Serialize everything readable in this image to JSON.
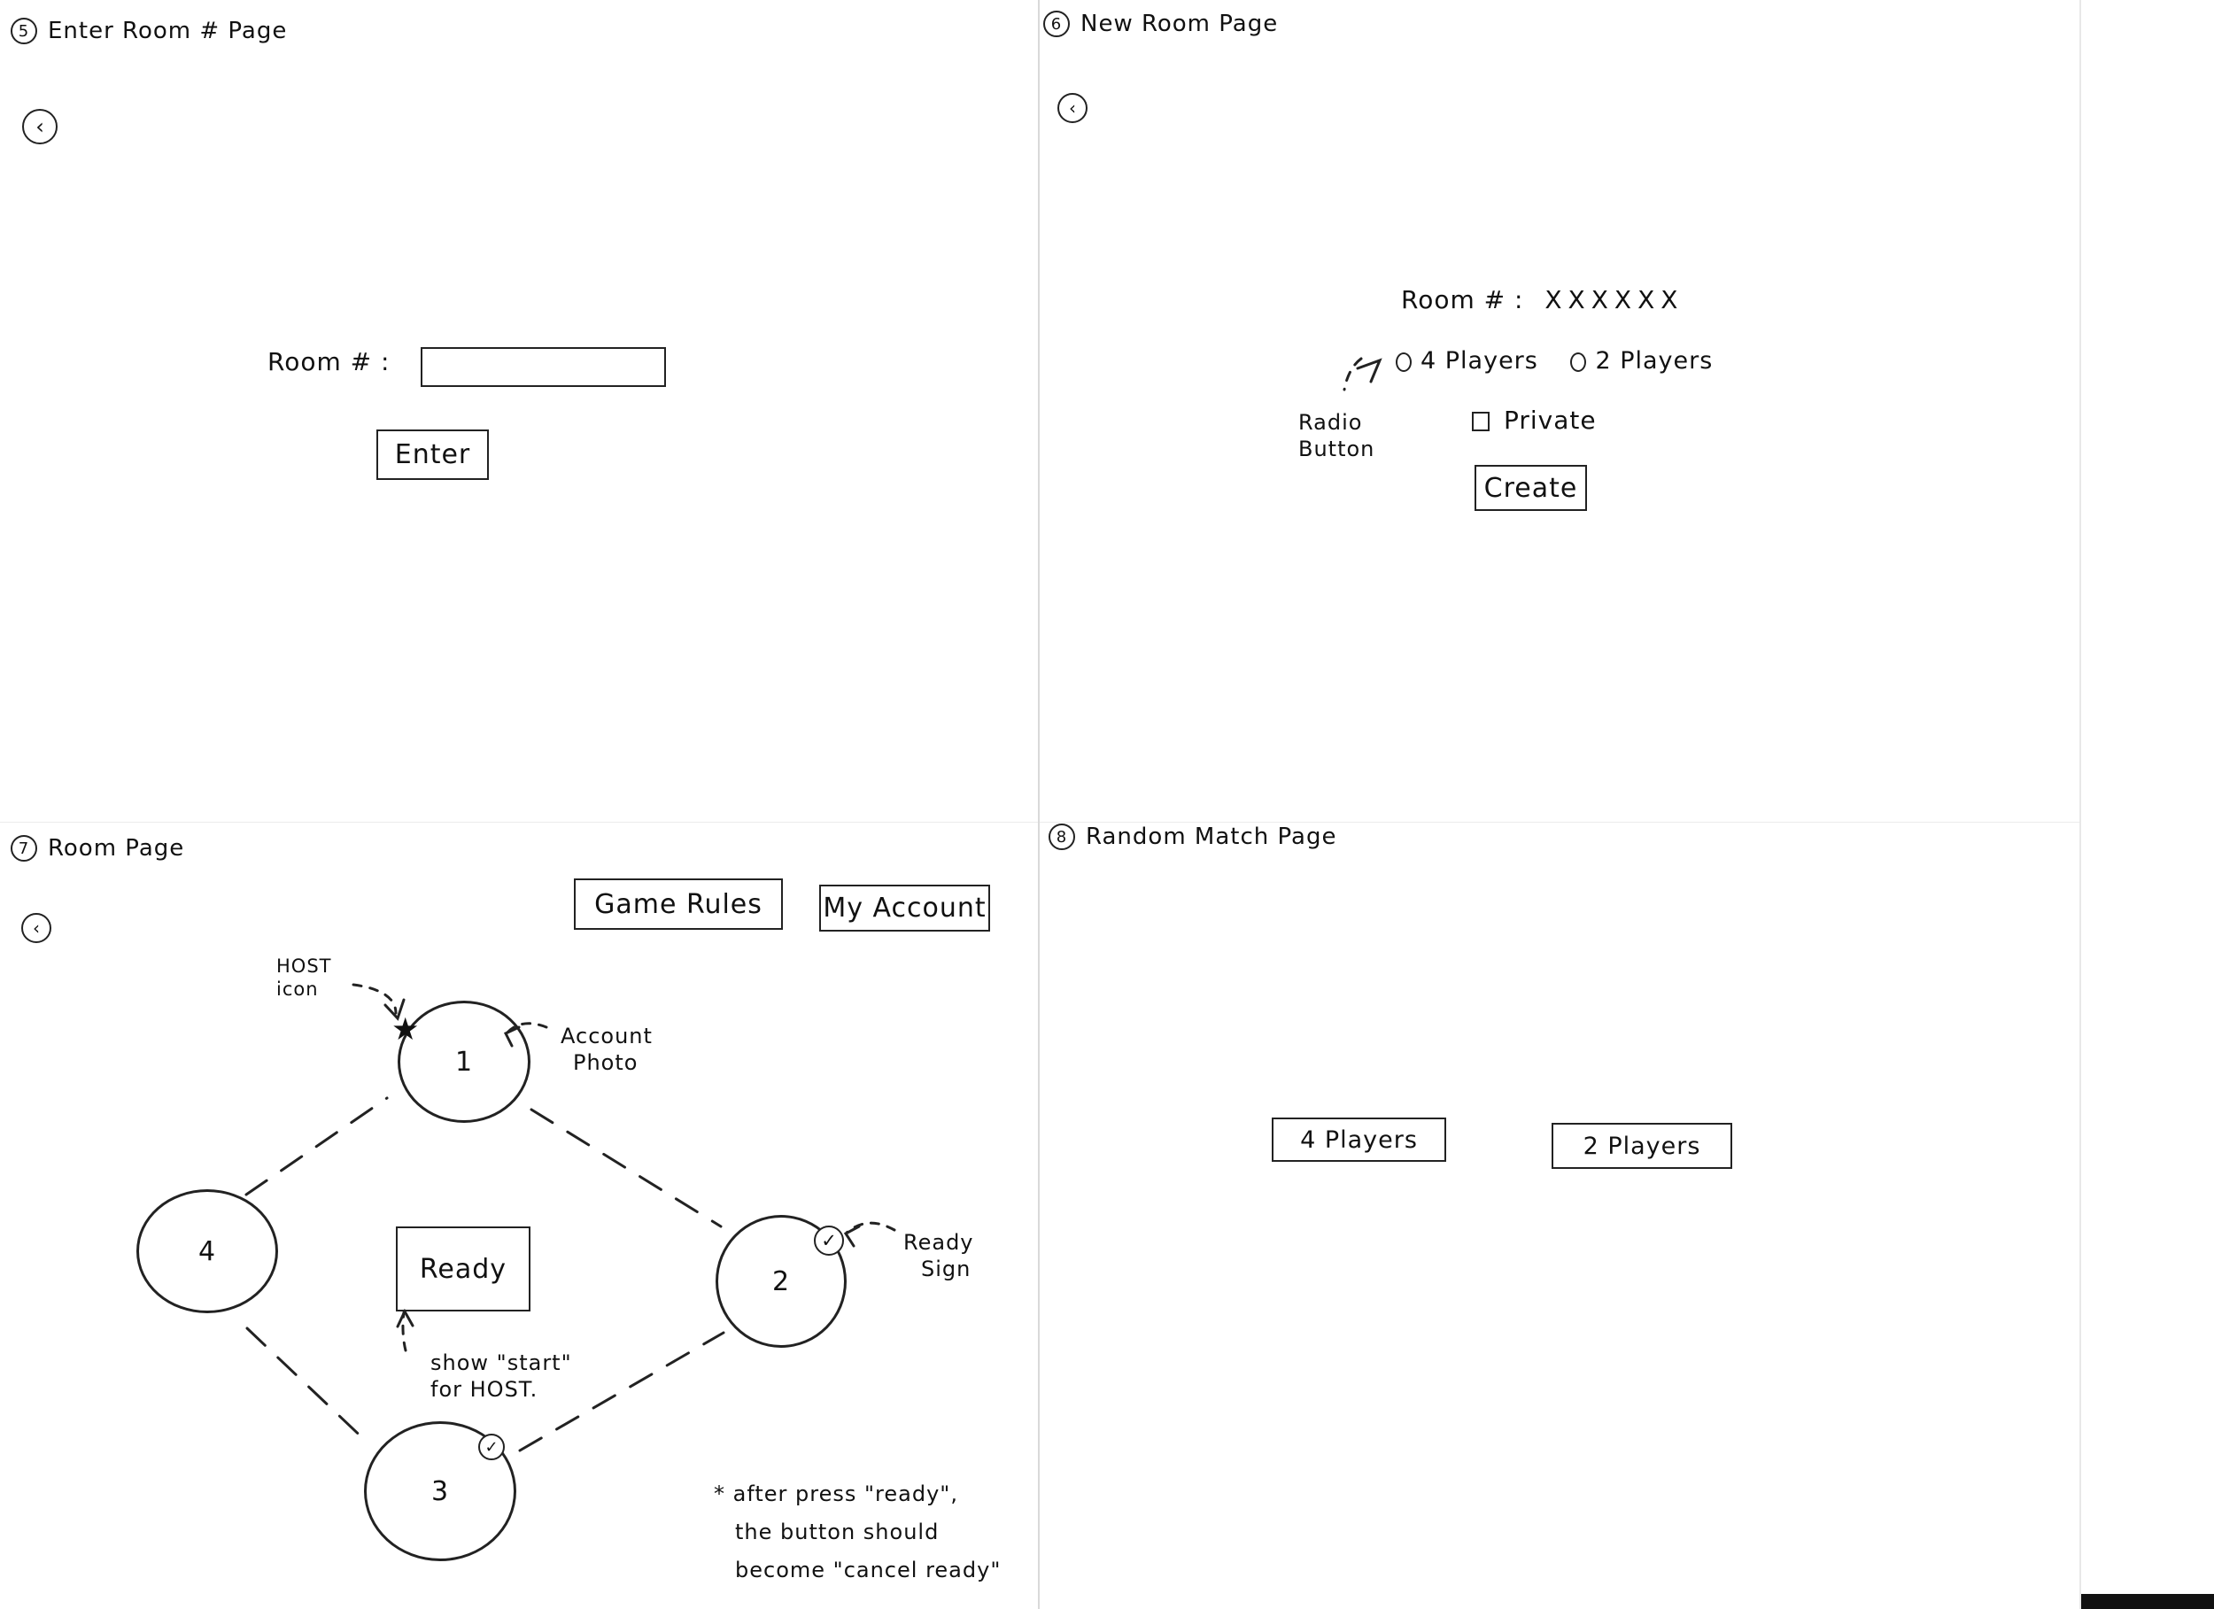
{
  "panels": {
    "enter_room": {
      "badge": "5",
      "title": "Enter Room # Page",
      "back_icon": "back-arrow-icon",
      "room_label": "Room # :",
      "room_value": "",
      "enter_button": "Enter"
    },
    "new_room": {
      "badge": "6",
      "title": "New Room Page",
      "back_icon": "back-arrow-icon",
      "room_label": "Room # :",
      "room_value": "XXXXXX",
      "radio_4": "4 Players",
      "radio_2": "2 Players",
      "private_label": "Private",
      "create_button": "Create",
      "radio_note_1": "Radio",
      "radio_note_2": "Button"
    },
    "room": {
      "badge": "7",
      "title": "Room Page",
      "back_icon": "back-arrow-icon",
      "game_rules_button": "Game Rules",
      "my_account_button": "My Account",
      "host_note_1": "HOST",
      "host_note_2": "icon",
      "account_note_1": "Account",
      "account_note_2": "Photo",
      "ready_note_1": "Ready",
      "ready_note_2": "Sign",
      "ready_button": "Ready",
      "start_note_1": "show \"start\"",
      "start_note_2": "for HOST.",
      "footer_note_1": "* after press \"ready\",",
      "footer_note_2": "the button should",
      "footer_note_3": "become \"cancel ready\"",
      "players": [
        "1",
        "2",
        "3",
        "4"
      ]
    },
    "random_match": {
      "badge": "8",
      "title": "Random Match Page",
      "four_players_button": "4 Players",
      "two_players_button": "2 Players"
    }
  },
  "icons": {
    "host": "star-icon",
    "ready": "check-icon"
  },
  "colors": {
    "ink": "#151515",
    "paper": "#ffffff",
    "divider": "#d9d9d9"
  }
}
